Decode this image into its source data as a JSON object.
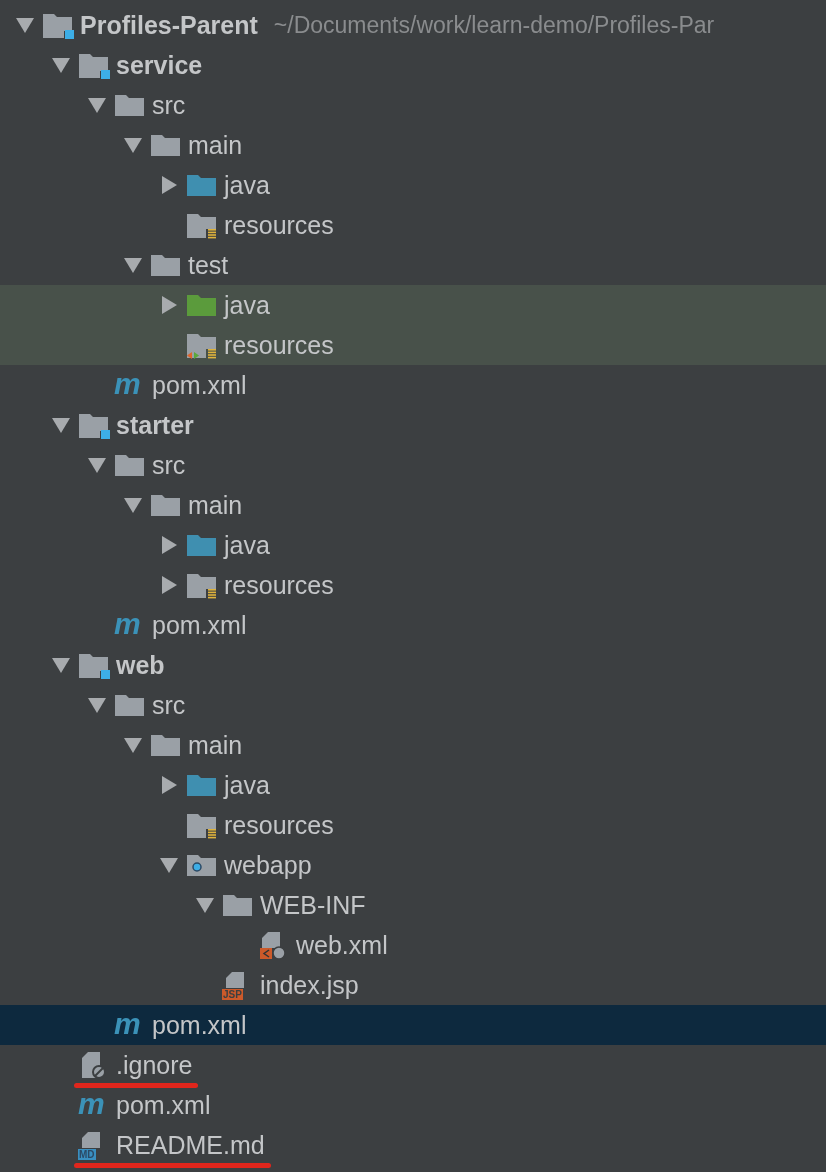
{
  "tree": [
    {
      "kind": "project",
      "label": "Profiles-Parent",
      "path": "~/Documents/work/learn-demo/Profiles-Par",
      "expanded": true,
      "children": [
        {
          "kind": "module",
          "label": "service",
          "expanded": true,
          "children": [
            {
              "kind": "folder",
              "label": "src",
              "expanded": true,
              "children": [
                {
                  "kind": "folder",
                  "label": "main",
                  "expanded": true,
                  "children": [
                    {
                      "kind": "source",
                      "label": "java",
                      "expanded": false
                    },
                    {
                      "kind": "resources",
                      "label": "resources"
                    }
                  ]
                },
                {
                  "kind": "folder",
                  "label": "test",
                  "expanded": true,
                  "children": [
                    {
                      "kind": "test-source",
                      "label": "java",
                      "expanded": false,
                      "tinted": true
                    },
                    {
                      "kind": "test-resources",
                      "label": "resources",
                      "tinted": true
                    }
                  ]
                }
              ]
            },
            {
              "kind": "maven",
              "label": "pom.xml",
              "icon_text": "m"
            }
          ]
        },
        {
          "kind": "module",
          "label": "starter",
          "expanded": true,
          "children": [
            {
              "kind": "folder",
              "label": "src",
              "expanded": true,
              "children": [
                {
                  "kind": "folder",
                  "label": "main",
                  "expanded": true,
                  "children": [
                    {
                      "kind": "source",
                      "label": "java",
                      "expanded": false
                    },
                    {
                      "kind": "resources",
                      "label": "resources",
                      "expanded": false
                    }
                  ]
                }
              ]
            },
            {
              "kind": "maven",
              "label": "pom.xml",
              "icon_text": "m"
            }
          ]
        },
        {
          "kind": "module",
          "label": "web",
          "expanded": true,
          "children": [
            {
              "kind": "folder",
              "label": "src",
              "expanded": true,
              "children": [
                {
                  "kind": "folder",
                  "label": "main",
                  "expanded": true,
                  "children": [
                    {
                      "kind": "source",
                      "label": "java",
                      "expanded": false
                    },
                    {
                      "kind": "resources",
                      "label": "resources"
                    },
                    {
                      "kind": "web",
                      "label": "webapp",
                      "expanded": true,
                      "children": [
                        {
                          "kind": "folder",
                          "label": "WEB-INF",
                          "expanded": true,
                          "children": [
                            {
                              "kind": "webxml",
                              "label": "web.xml"
                            }
                          ]
                        },
                        {
                          "kind": "jsp",
                          "label": "index.jsp",
                          "icon_text": "JSP"
                        }
                      ]
                    }
                  ]
                }
              ]
            },
            {
              "kind": "maven",
              "label": "pom.xml",
              "icon_text": "m",
              "selected": true
            }
          ]
        },
        {
          "kind": "ignore",
          "label": ".ignore",
          "underlined": true
        },
        {
          "kind": "maven",
          "label": "pom.xml",
          "icon_text": "m"
        },
        {
          "kind": "markdown",
          "label": "README.md",
          "icon_text": "MD",
          "underlined": true
        }
      ]
    }
  ]
}
